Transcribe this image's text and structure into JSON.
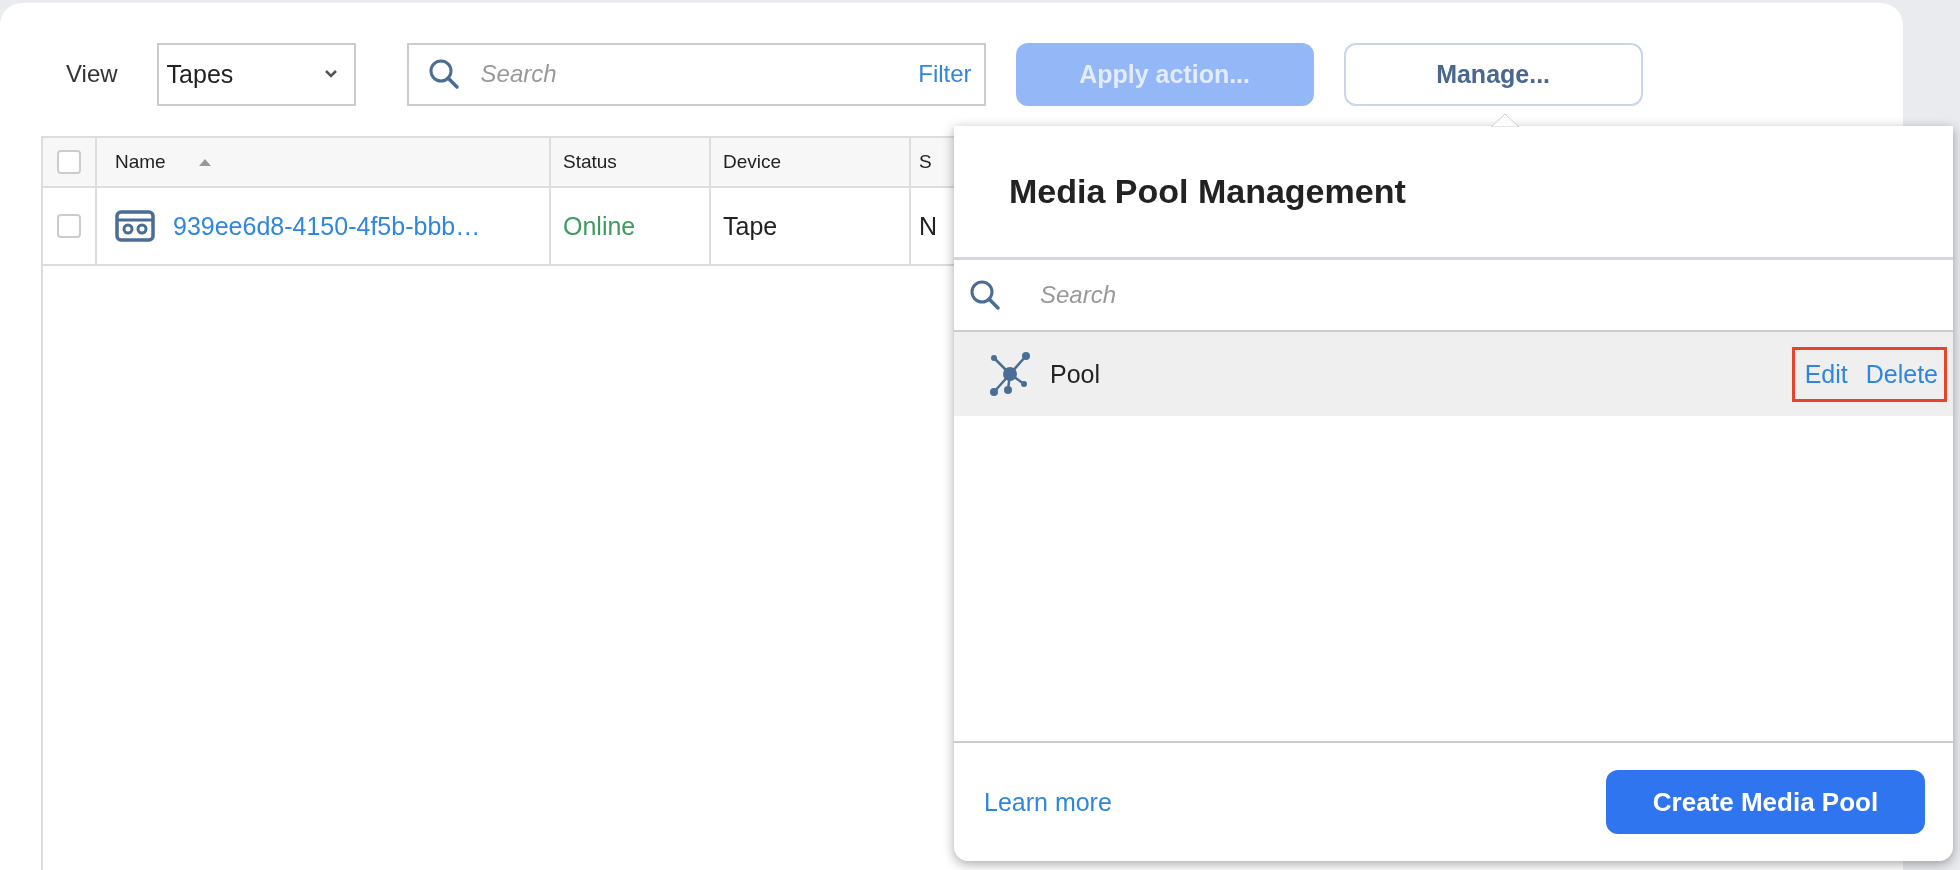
{
  "toolbar": {
    "view_label": "View",
    "view_select": {
      "value": "Tapes"
    },
    "search": {
      "placeholder": "Search",
      "filter_link": "Filter"
    },
    "apply_button": {
      "label": "Apply action...",
      "disabled": true
    },
    "manage_button": {
      "label": "Manage..."
    }
  },
  "table": {
    "header_checkbox": {
      "checked": false
    },
    "columns": [
      {
        "label": "Name",
        "sorted": true
      },
      {
        "label": "Status",
        "sorted": false
      },
      {
        "label": "Device",
        "sorted": false
      },
      {
        "label": "S",
        "sorted": false
      }
    ],
    "rows": [
      {
        "checked": false,
        "name": "939ee6d8-4150-4f5b-bbb…",
        "status": "Online",
        "device": "Tape",
        "column_4": "N"
      }
    ]
  },
  "popover": {
    "title": "Media Pool Management",
    "search": {
      "placeholder": "Search"
    },
    "items": [
      {
        "name": "Pool",
        "selected": true,
        "actions": [
          "Edit",
          "Delete"
        ],
        "highlighted": true
      }
    ],
    "learn_more": "Learn more",
    "create_button": "Create Media Pool"
  }
}
